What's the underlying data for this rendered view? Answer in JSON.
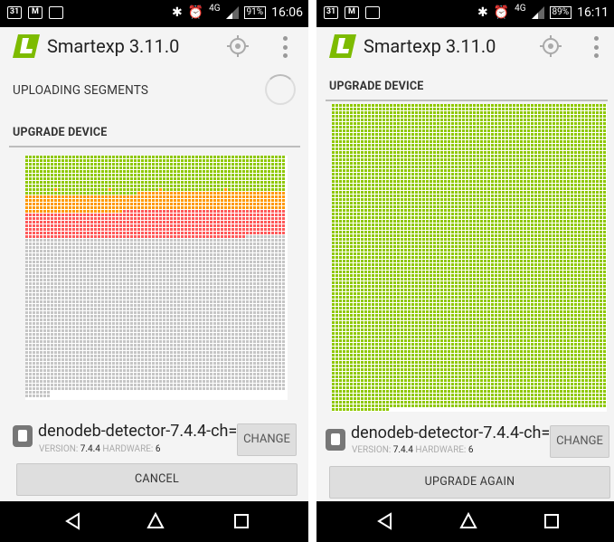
{
  "left": {
    "status": {
      "time": "16:06",
      "battery": "91%",
      "network": "4G",
      "calendar_day": "31"
    },
    "app_title": "Smartexp 3.11.0",
    "uploading_label": "UPLOADING SEGMENTS",
    "section_label": "UPGRADE DEVICE",
    "progress": {
      "green": 0.17,
      "orange": 0.07,
      "red": 0.1,
      "grey": 0.66
    },
    "device": {
      "name": "denodeb-detector-7.4.4-ch=..",
      "version_label": "VERSION:",
      "version": "7.4.4",
      "hardware_label": "HARDWARE:",
      "hardware": "6",
      "change_label": "CHANGE"
    },
    "action_label": "CANCEL"
  },
  "right": {
    "status": {
      "time": "16:11",
      "battery": "89%",
      "network": "4G",
      "calendar_day": "31"
    },
    "app_title": "Smartexp 3.11.0",
    "section_label": "UPGRADE DEVICE",
    "progress": {
      "green": 1.0
    },
    "device": {
      "name": "denodeb-detector-7.4.4-ch=..",
      "version_label": "VERSION:",
      "version": "7.4.4",
      "hardware_label": "HARDWARE:",
      "hardware": "6",
      "change_label": "CHANGE"
    },
    "action_label": "UPGRADE AGAIN"
  },
  "icons": [
    "calendar-icon",
    "gmail-icon",
    "image-icon",
    "bluetooth-icon",
    "alarm-icon",
    "signal-icon",
    "battery-icon",
    "app-logo-icon",
    "location-target-icon",
    "overflow-menu-icon",
    "spinner-icon",
    "device-icon",
    "nav-back-icon",
    "nav-home-icon",
    "nav-recents-icon"
  ],
  "colors": {
    "green": "#8fc800",
    "orange": "#ff9900",
    "red": "#ff5a5a",
    "grey": "#c6c6c6"
  }
}
